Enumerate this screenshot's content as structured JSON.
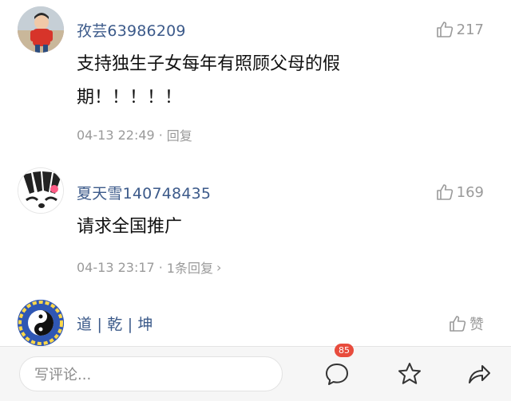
{
  "comments": [
    {
      "username": "孜芸63986209",
      "likes": "217",
      "text": "支持独生子女每年有照顾父母的假期！！！！！",
      "date": "04-13 22:49",
      "reply_label": "回复"
    },
    {
      "username": "夏天雪140748435",
      "likes": "169",
      "text": "请求全国推广",
      "date": "04-13 23:17",
      "reply_label": "1条回复"
    },
    {
      "username": "道 | 乾 | 坤",
      "likes": "赞"
    }
  ],
  "footer": {
    "input_placeholder": "写评论...",
    "comment_count": "85"
  },
  "icons": {
    "like": "thumbs-up-icon",
    "comment": "comment-bubble-icon",
    "favorite": "star-icon",
    "share": "share-arrow-icon"
  },
  "colors": {
    "username": "#3c5a8a",
    "meta": "#9a9a9a",
    "badge": "#e84c3d"
  }
}
